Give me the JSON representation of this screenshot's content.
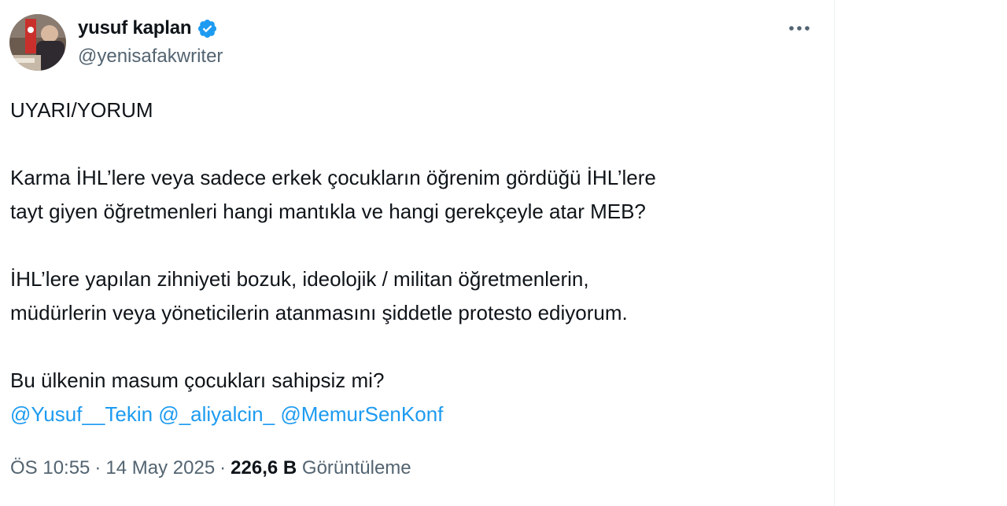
{
  "author": {
    "display_name": "yusuf kaplan",
    "handle": "@yenisafakwriter",
    "verified": true
  },
  "tweet": {
    "lines": [
      "UYARI/YORUM",
      "",
      "Karma İHL’lere veya sadece erkek çocukların öğrenim gördüğü İHL’lere",
      "tayt giyen öğretmenleri hangi mantıkla ve hangi gerekçeyle atar MEB?",
      "",
      "İHL’lere yapılan zihniyeti bozuk, ideolojik / militan öğretmenlerin,",
      "müdürlerin veya yöneticilerin atanmasını şiddetle protesto ediyorum.",
      "",
      "Bu ülkenin masum çocukları sahipsiz mi?"
    ],
    "mentions": [
      "@Yusuf__Tekin",
      "@_aliyalcin_",
      "@MemurSenKonf"
    ]
  },
  "meta": {
    "time": "ÖS 10:55",
    "date": "14 May 2025",
    "views_count": "226,6 B",
    "views_label": "Görüntüleme",
    "separator": "·"
  },
  "icons": {
    "verified": "verified-badge-icon",
    "more": "more-options-icon"
  },
  "colors": {
    "accent": "#1d9bf0",
    "text": "#0f1419",
    "muted": "#536471"
  }
}
